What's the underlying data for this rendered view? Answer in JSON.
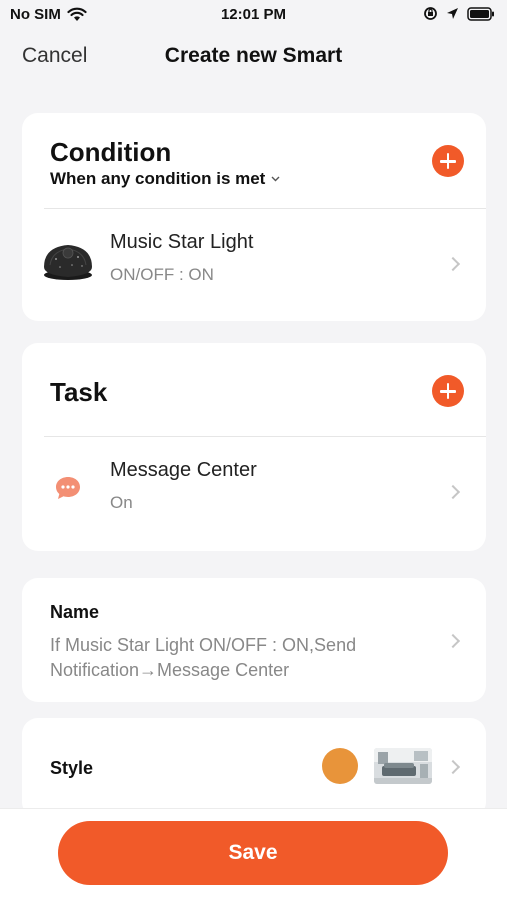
{
  "status_bar": {
    "carrier": "No SIM",
    "time": "12:01 PM"
  },
  "nav": {
    "cancel_label": "Cancel",
    "title": "Create new Smart"
  },
  "condition": {
    "heading": "Condition",
    "mode": "When any condition is met",
    "items": [
      {
        "title": "Music Star Light",
        "subtitle": "ON/OFF : ON",
        "icon": "star-projector-device-icon"
      }
    ]
  },
  "task": {
    "heading": "Task",
    "items": [
      {
        "title": "Message Center",
        "subtitle": "On",
        "icon": "message-bubble-icon"
      }
    ]
  },
  "name": {
    "label": "Name",
    "value": "If Music Star Light ON/OFF : ON,Send Notification→Message Center"
  },
  "style": {
    "label": "Style",
    "color": "#e8943a"
  },
  "save_label": "Save",
  "colors": {
    "accent": "#f15a29",
    "background": "#f4f4f6",
    "card": "#ffffff"
  }
}
